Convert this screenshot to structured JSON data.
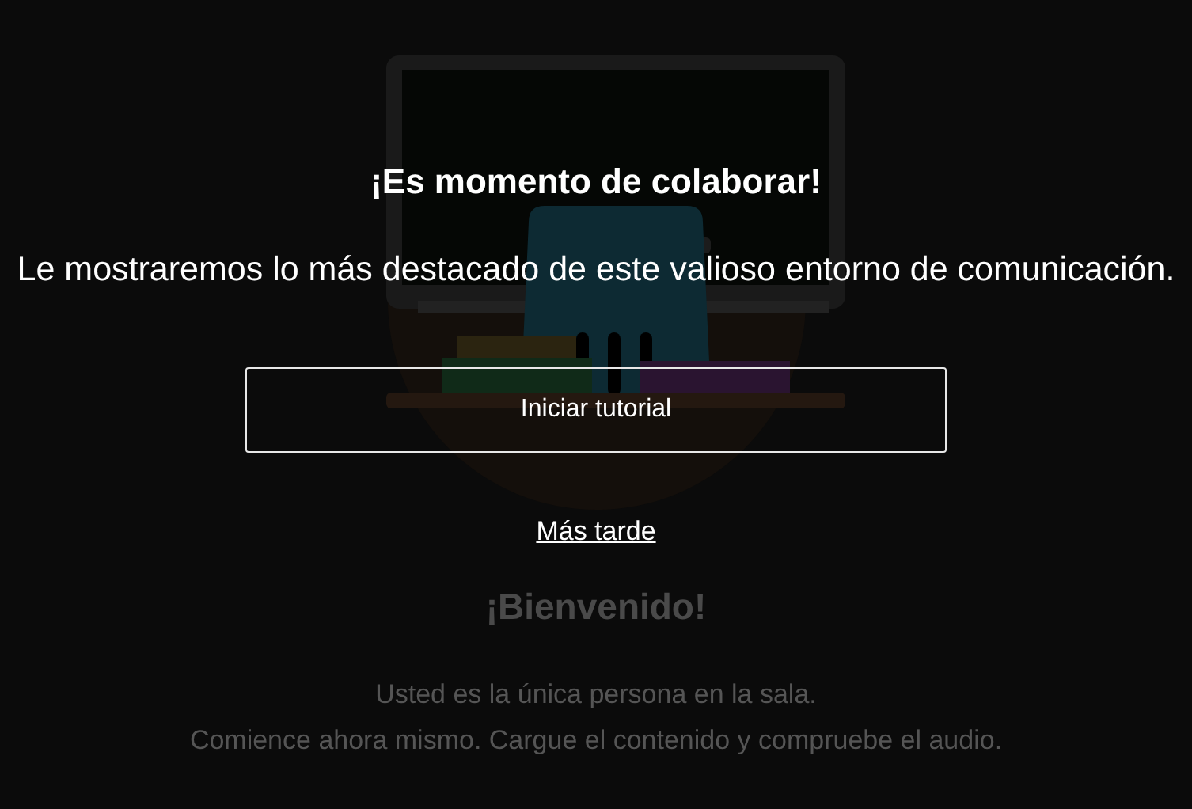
{
  "welcome": {
    "heading": "¡Bienvenido!",
    "lines": [
      "Usted es la única persona en la sala.",
      "Comience ahora mismo. Cargue el contenido y compruebe el audio."
    ]
  },
  "dialog": {
    "title": "¡Es momento de colaborar!",
    "message": "Le mostraremos lo más destacado de este valioso entorno de comunicación.",
    "button": "Iniciar tutorial",
    "link": "Más tarde"
  }
}
